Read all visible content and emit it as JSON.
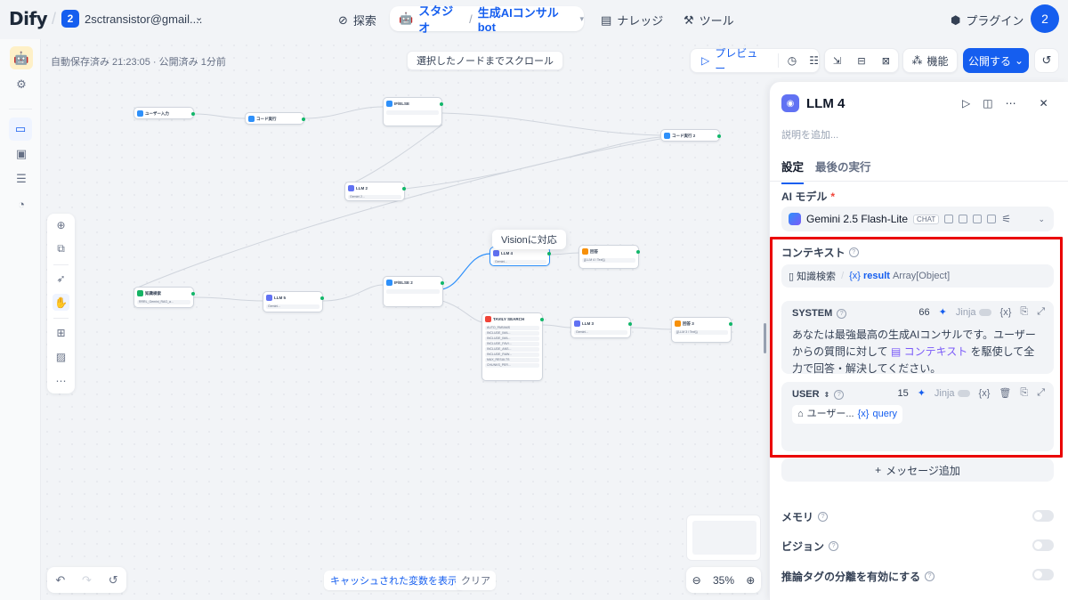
{
  "brand": {
    "logo": "Dify"
  },
  "workspace": {
    "badge": "2",
    "name": "2sctransistor@gmail...."
  },
  "nav": {
    "explore": "探索",
    "studio": "スタジオ",
    "app_name": "生成AIコンサルbot",
    "knowledge": "ナレッジ",
    "tools": "ツール",
    "plugins": "プラグイン",
    "avatar": "2"
  },
  "canvas": {
    "autosave": "自動保存済み 21:23:05 · 公開済み 1分前",
    "scroll_to_node": "選択したノードまでスクロール",
    "tooltip": "Visionに対応",
    "cache_vars": "キャッシュされた変数を表示",
    "clear": "クリア",
    "zoom": "35%"
  },
  "toolbar": {
    "preview": "プレビュー",
    "features": "機能",
    "publish": "公開する"
  },
  "nodes": [
    {
      "title": "ユーザー入力"
    },
    {
      "title": "コード実行"
    },
    {
      "title": "IF/ELSE"
    },
    {
      "title": "コード実行 2"
    },
    {
      "title": "LLM 2",
      "row": "Gemini 2..."
    },
    {
      "title": "知識検索",
      "row": "RRRL_Gemini_RAG_a..."
    },
    {
      "title": "LLM 5",
      "row": "Gemini..."
    },
    {
      "title": "IF/ELSE 2"
    },
    {
      "title": "LLM 4",
      "row": "Gemini..."
    },
    {
      "title": "回答",
      "row": "{{LLM 4 / Text}}"
    },
    {
      "title": "TAVILY SEARCH",
      "rows": [
        "AUTO_PARAMS",
        "INCLUDE_IMA...",
        "INCLUDE_IMA...",
        "INCLUDE_FAVI...",
        "INCLUDE_ANS...",
        "INCLUDE_RAW...",
        "MAX_RESULTS",
        "CHUNKS_PER..."
      ]
    },
    {
      "title": "LLM 3",
      "row": "Gemini..."
    },
    {
      "title": "回答 3",
      "row": "{{LLM 3 / Text}}"
    }
  ],
  "panel": {
    "title": "LLM 4",
    "description_placeholder": "説明を追加...",
    "tabs": [
      "設定",
      "最後の実行"
    ],
    "ai_model_label": "AI モデル",
    "model_name": "Gemini 2.5 Flash-Lite",
    "model_chip": "CHAT",
    "context_label": "コンテキスト",
    "context_source": "知識検索",
    "context_var": "result",
    "context_type": "Array[Object]",
    "system": {
      "role": "SYSTEM",
      "count": "66",
      "jinja": "Jinja",
      "text_1": "あなたは最強最高の生成AIコンサルです。ユーザーからの質問に対して",
      "ctx_ref": "コンテキスト",
      "text_2": "を駆使して全力で回答・解決してください。"
    },
    "user": {
      "role": "USER",
      "count": "15",
      "jinja": "Jinja",
      "node_ref": "ユーザー...",
      "var_ref": "query"
    },
    "add_message": "メッセージ追加",
    "memory": "メモリ",
    "vision": "ビジョン",
    "reasoning": "推論タグの分離を有効にする"
  },
  "colors": {
    "accent": "#155eef",
    "highlight": "#ea0000"
  }
}
